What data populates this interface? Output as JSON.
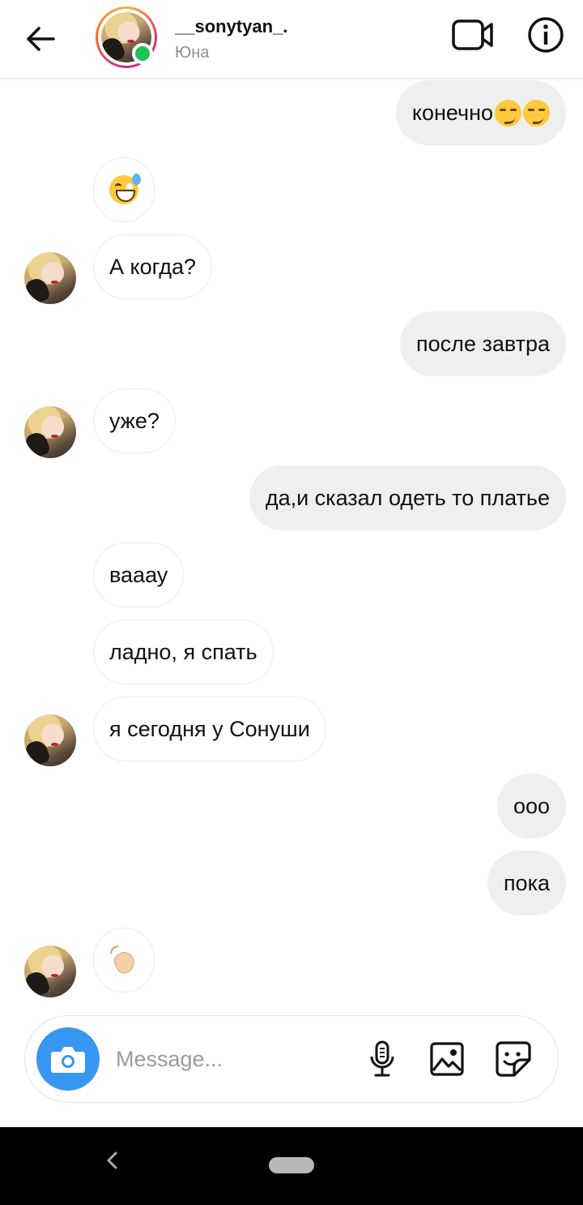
{
  "header": {
    "username": "__sonytyan_.",
    "real_name": "Юна"
  },
  "messages": [
    {
      "side": "out",
      "text": "конечно",
      "emoji": [
        "smirking-face",
        "smirking-face"
      ]
    },
    {
      "side": "in",
      "emoji_only": "grinning-face-with-sweat"
    },
    {
      "side": "in",
      "text": "А когда?",
      "avatar": true
    },
    {
      "side": "out",
      "text": "после завтра"
    },
    {
      "side": "in",
      "text": "уже?",
      "avatar": true
    },
    {
      "side": "out",
      "text": "да,и сказал одеть то платье"
    },
    {
      "side": "in",
      "text": "вааау"
    },
    {
      "side": "in",
      "text": "ладно, я спать"
    },
    {
      "side": "in",
      "text": "я сегодня у Сонуши",
      "avatar": true
    },
    {
      "side": "out",
      "text": "ооо"
    },
    {
      "side": "out",
      "text": "пока"
    },
    {
      "side": "in",
      "emoji_only": "waving-hand",
      "avatar": true
    }
  ],
  "composer": {
    "placeholder": "Message..."
  },
  "colors": {
    "accent_blue": "#3897f0",
    "online_green": "#1fc15a",
    "outgoing_bubble": "#efefef"
  }
}
